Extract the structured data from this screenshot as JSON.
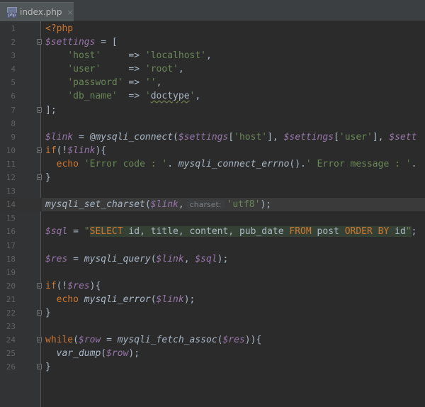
{
  "tab": {
    "filename": "index.php",
    "icon": "php-file-icon",
    "icon_label": "php",
    "close_glyph": "×"
  },
  "editor": {
    "current_line": 14,
    "lines": [
      {
        "n": "1",
        "fold": false,
        "tokens": [
          [
            "kw",
            "<?php"
          ]
        ]
      },
      {
        "n": "2",
        "fold": true,
        "tokens": [
          [
            "var",
            "$settings"
          ],
          [
            "plain",
            " = ["
          ]
        ]
      },
      {
        "n": "3",
        "fold": false,
        "tokens": [
          [
            "plain",
            "    "
          ],
          [
            "str",
            "'host'"
          ],
          [
            "plain",
            "     => "
          ],
          [
            "str",
            "'localhost'"
          ],
          [
            "plain",
            ","
          ]
        ]
      },
      {
        "n": "4",
        "fold": false,
        "tokens": [
          [
            "plain",
            "    "
          ],
          [
            "str",
            "'user'"
          ],
          [
            "plain",
            "     => "
          ],
          [
            "str",
            "'root'"
          ],
          [
            "plain",
            ","
          ]
        ]
      },
      {
        "n": "5",
        "fold": false,
        "tokens": [
          [
            "plain",
            "    "
          ],
          [
            "str",
            "'password'"
          ],
          [
            "plain",
            " => "
          ],
          [
            "str",
            "''"
          ],
          [
            "plain",
            ","
          ]
        ]
      },
      {
        "n": "6",
        "fold": false,
        "tokens": [
          [
            "plain",
            "    "
          ],
          [
            "str",
            "'db_name'"
          ],
          [
            "plain",
            "  => "
          ],
          [
            "str",
            "'"
          ],
          [
            "ws",
            "doctype"
          ],
          [
            "str",
            "'"
          ],
          [
            "plain",
            ","
          ]
        ]
      },
      {
        "n": "7",
        "fold": true,
        "tokens": [
          [
            "plain",
            "];"
          ]
        ]
      },
      {
        "n": "8",
        "fold": false,
        "tokens": []
      },
      {
        "n": "9",
        "fold": false,
        "tokens": [
          [
            "var",
            "$link"
          ],
          [
            "plain",
            " = @"
          ],
          [
            "fn",
            "mysqli_connect"
          ],
          [
            "plain",
            "("
          ],
          [
            "var",
            "$settings"
          ],
          [
            "plain",
            "["
          ],
          [
            "str",
            "'host'"
          ],
          [
            "plain",
            "], "
          ],
          [
            "var",
            "$settings"
          ],
          [
            "plain",
            "["
          ],
          [
            "str",
            "'user'"
          ],
          [
            "plain",
            "], "
          ],
          [
            "var",
            "$sett"
          ]
        ]
      },
      {
        "n": "10",
        "fold": true,
        "tokens": [
          [
            "kw",
            "if"
          ],
          [
            "plain",
            "(!"
          ],
          [
            "var",
            "$link"
          ],
          [
            "plain",
            "){"
          ]
        ]
      },
      {
        "n": "11",
        "fold": false,
        "tokens": [
          [
            "plain",
            "  "
          ],
          [
            "kw",
            "echo "
          ],
          [
            "str",
            "'Error code : '"
          ],
          [
            "plain",
            ". "
          ],
          [
            "fn",
            "mysqli_connect_errno"
          ],
          [
            "plain",
            "()."
          ],
          [
            "str",
            "' Error message : '"
          ],
          [
            "plain",
            "."
          ]
        ]
      },
      {
        "n": "12",
        "fold": true,
        "tokens": [
          [
            "plain",
            "}"
          ]
        ]
      },
      {
        "n": "13",
        "fold": false,
        "tokens": []
      },
      {
        "n": "14",
        "fold": false,
        "tokens": [
          [
            "fn",
            "mysqli_set_charset"
          ],
          [
            "plain",
            "("
          ],
          [
            "var",
            "$link"
          ],
          [
            "plain",
            ","
          ],
          [
            "hint",
            "charset:"
          ],
          [
            "str",
            "'utf8'"
          ],
          [
            "plain",
            ");"
          ]
        ]
      },
      {
        "n": "15",
        "fold": false,
        "tokens": []
      },
      {
        "n": "16",
        "fold": false,
        "tokens": [
          [
            "var",
            "$sql"
          ],
          [
            "plain",
            " = "
          ],
          [
            "str",
            "\""
          ],
          [
            "sqlkw",
            "SELECT "
          ],
          [
            "sql",
            "id, title, content, pub_date "
          ],
          [
            "sqlkw",
            "FROM "
          ],
          [
            "sql",
            "post "
          ],
          [
            "sqlkw",
            "ORDER BY "
          ],
          [
            "sql",
            "id"
          ],
          [
            "sqlq",
            "\""
          ],
          [
            "plain",
            ";"
          ]
        ]
      },
      {
        "n": "17",
        "fold": false,
        "tokens": []
      },
      {
        "n": "18",
        "fold": false,
        "tokens": [
          [
            "var",
            "$res"
          ],
          [
            "plain",
            " = "
          ],
          [
            "fn",
            "mysqli_query"
          ],
          [
            "plain",
            "("
          ],
          [
            "var",
            "$link"
          ],
          [
            "plain",
            ", "
          ],
          [
            "var",
            "$sql"
          ],
          [
            "plain",
            ");"
          ]
        ]
      },
      {
        "n": "19",
        "fold": false,
        "tokens": []
      },
      {
        "n": "20",
        "fold": true,
        "tokens": [
          [
            "kw",
            "if"
          ],
          [
            "plain",
            "(!"
          ],
          [
            "var",
            "$res"
          ],
          [
            "plain",
            "){"
          ]
        ]
      },
      {
        "n": "21",
        "fold": false,
        "tokens": [
          [
            "plain",
            "  "
          ],
          [
            "kw",
            "echo "
          ],
          [
            "fn",
            "mysqli_error"
          ],
          [
            "plain",
            "("
          ],
          [
            "var",
            "$link"
          ],
          [
            "plain",
            ");"
          ]
        ]
      },
      {
        "n": "22",
        "fold": true,
        "tokens": [
          [
            "plain",
            "}"
          ]
        ]
      },
      {
        "n": "23",
        "fold": false,
        "tokens": []
      },
      {
        "n": "24",
        "fold": true,
        "tokens": [
          [
            "kw",
            "while"
          ],
          [
            "plain",
            "("
          ],
          [
            "var",
            "$row"
          ],
          [
            "plain",
            " = "
          ],
          [
            "fn",
            "mysqli_fetch_assoc"
          ],
          [
            "plain",
            "("
          ],
          [
            "var",
            "$res"
          ],
          [
            "plain",
            ")){"
          ]
        ]
      },
      {
        "n": "25",
        "fold": false,
        "tokens": [
          [
            "plain",
            "  "
          ],
          [
            "fn",
            "var_dump"
          ],
          [
            "plain",
            "("
          ],
          [
            "var",
            "$row"
          ],
          [
            "plain",
            ");"
          ]
        ]
      },
      {
        "n": "26",
        "fold": true,
        "tokens": [
          [
            "plain",
            "}"
          ]
        ]
      }
    ]
  },
  "colors": {
    "background": "#2b2b2b",
    "keyword": "#cc7832",
    "variable": "#9876aa",
    "string": "#6a8759",
    "default_text": "#a9b7c6",
    "line_number": "#606366"
  }
}
